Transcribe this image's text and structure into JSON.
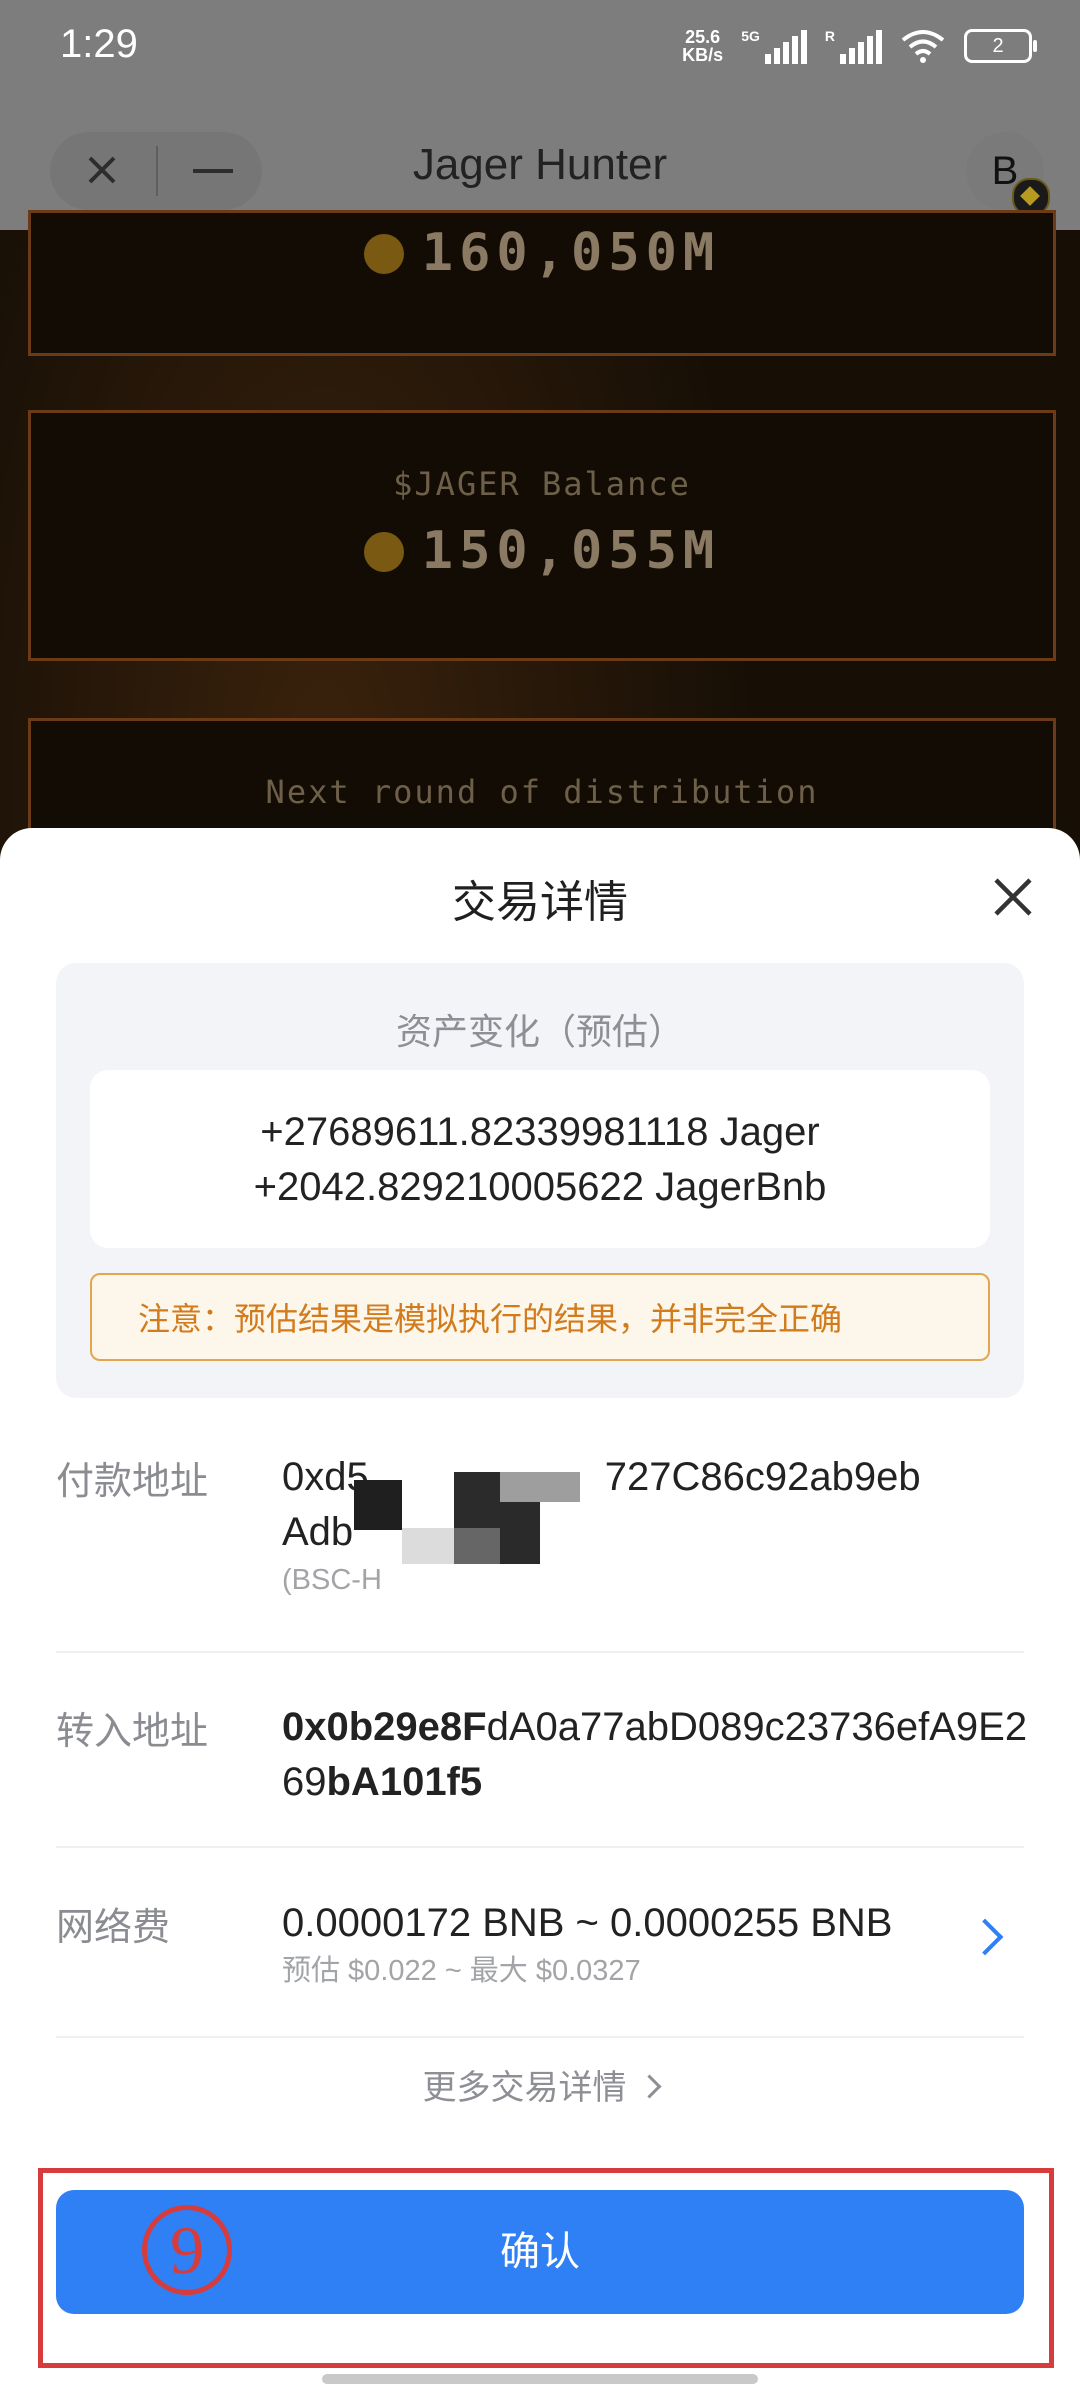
{
  "status_bar": {
    "time": "1:29",
    "speed_value": "25.6",
    "speed_unit": "KB/s",
    "network": "5G",
    "roaming": "R",
    "battery": "2"
  },
  "app_bar": {
    "title": "Jager Hunter",
    "avatar_letter": "B"
  },
  "game": {
    "box1_value": "160,050M",
    "box2_label": "$JAGER Balance",
    "box2_value": "150,055M",
    "box3_label": "Next round of distribution"
  },
  "sheet": {
    "title": "交易详情",
    "asset_change_title": "资产变化（预估）",
    "asset_changes": [
      "+27689611.82339981118 Jager",
      "+2042.829210005622 JagerBnb"
    ],
    "warning": "注意：预估结果是模拟执行的结果，并非完全正确",
    "pay_address_label": "付款地址",
    "pay_address_start": "0xd5",
    "pay_address_end": "727C86c92ab9eb",
    "pay_address_line2": "Adb",
    "pay_network": "(BSC-H",
    "to_address_label": "转入地址",
    "to_address_bold_start": "0x0b29e8F",
    "to_address_middle": "dA0a77abD089c23736efA9E2",
    "to_address_line2_plain": "69",
    "to_address_bold_end": "bA101f5",
    "fee_label": "网络费",
    "fee_value": "0.0000172 BNB ~ 0.0000255 BNB",
    "fee_sub": "预估 $0.022 ~ 最大 $0.0327",
    "more_details": "更多交易详情",
    "confirm": "确认",
    "step_number": "9"
  },
  "colors": {
    "accent": "#2f7ff5",
    "warning_text": "#d27b1d",
    "warning_border": "#e2a64e",
    "annotation_red": "#d63c3c"
  }
}
